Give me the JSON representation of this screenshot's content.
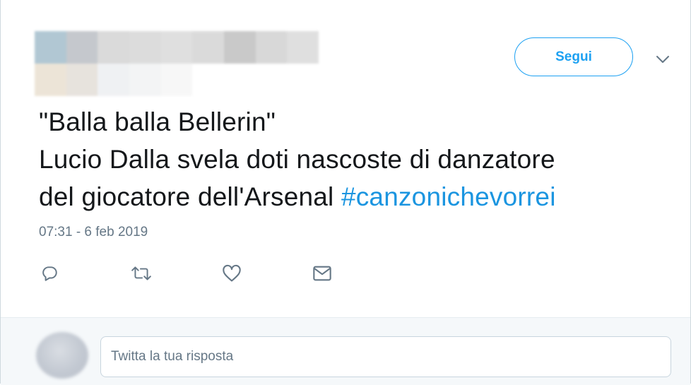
{
  "header": {
    "follow_label": "Segui",
    "menu_icon": "chevron-down-icon"
  },
  "tweet": {
    "lines": [
      "\"Balla balla Bellerin\"",
      "Lucio Dalla svela doti nascoste di danzatore",
      "del giocatore dell'Arsenal"
    ],
    "hashtag": "#canzonichevorrei",
    "timestamp": "07:31 - 6 feb 2019"
  },
  "actions": [
    {
      "icon": "reply-icon"
    },
    {
      "icon": "retweet-icon"
    },
    {
      "icon": "like-icon"
    },
    {
      "icon": "direct-message-icon"
    }
  ],
  "reply": {
    "placeholder": "Twitta la tua risposta"
  },
  "colors": {
    "accent": "#1da1f2",
    "hashtag": "#1b95e0",
    "text": "#14171a",
    "muted": "#657786",
    "reply_bg": "#f5f8fa"
  }
}
